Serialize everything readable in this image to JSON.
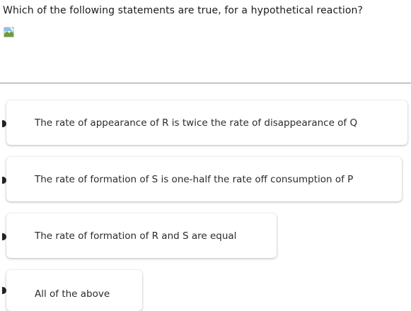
{
  "question": {
    "text": "Which of the following statements are true, for a hypothetical reaction?"
  },
  "image": {
    "icon": "broken-image-icon"
  },
  "options": [
    {
      "label": "The rate of appearance of R is twice the rate of disappearance of Q"
    },
    {
      "label": "The rate of formation of S is one-half the rate off consumption of P"
    },
    {
      "label": "The rate of formation of R and S are equal"
    },
    {
      "label": "All of the above"
    }
  ]
}
